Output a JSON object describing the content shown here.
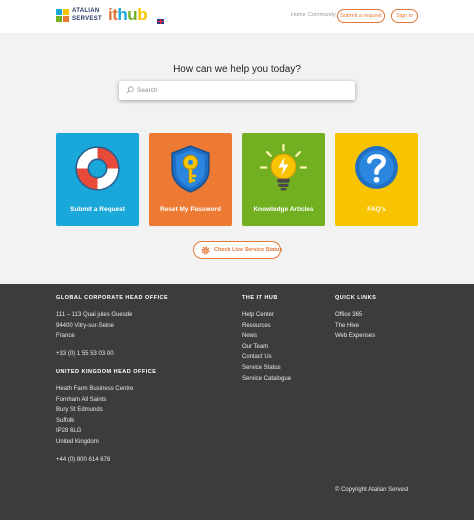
{
  "header": {
    "brand_line1": "ATALIAN",
    "brand_line2": "SERVEST",
    "product": {
      "i": "i",
      "t": "t",
      "h": "h",
      "u": "u",
      "b": "b"
    },
    "nav": [
      "Home",
      "Community"
    ],
    "submit_request": "Submit a request",
    "sign_in": "Sign in"
  },
  "hero": {
    "title": "How can we help you today?",
    "search_placeholder": "Search"
  },
  "cards": [
    {
      "label": "Submit a Request",
      "color": "#1aa7d9",
      "icon": "lifebuoy-icon"
    },
    {
      "label": "Reset My Password",
      "color": "#ed7a32",
      "icon": "key-shield-icon"
    },
    {
      "label": "Knowledge Articles",
      "color": "#72b022",
      "icon": "lightbulb-icon"
    },
    {
      "label": "FAQ's",
      "color": "#f8c300",
      "icon": "question-icon"
    }
  ],
  "status_button": "Check Live Service Status",
  "footer": {
    "corporate": {
      "heading": "GLOBAL CORPORATE HEAD OFFICE",
      "lines": [
        "111 – 113 Quai jules Guesde",
        "94400 Vitry-sur-Seine",
        "France"
      ],
      "phone": "+33 (0) 1 55 53 03 00"
    },
    "uk": {
      "heading": "UNITED KINGDOM HEAD OFFICE",
      "lines": [
        "Heath Farm Business Centre",
        "Fornham All Saints",
        "Bury St Edmunds",
        "Suffolk",
        "IP28 6LG",
        "United Kingdom"
      ],
      "phone": "+44 (0) 800 614 678"
    },
    "ithub": {
      "heading": "THE IT HUB",
      "links": [
        "Help Center",
        "Resources",
        "News",
        "Our Team",
        "Contact Us",
        "Service Status",
        "Service Catalogue"
      ]
    },
    "quick": {
      "heading": "QUICK LINKS",
      "links": [
        "Office 365",
        "The Hive",
        "Web Expenses"
      ]
    },
    "copyright": "© Copyright Atalian Servest"
  }
}
